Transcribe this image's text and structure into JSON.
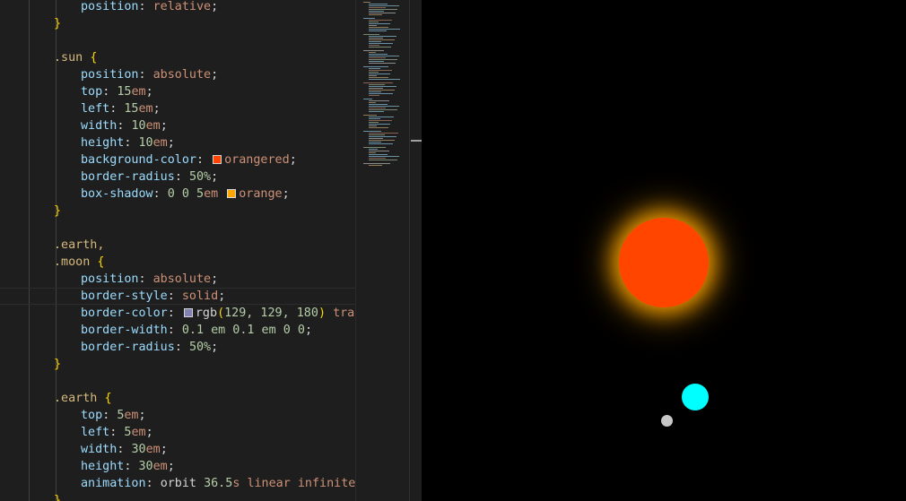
{
  "code": {
    "l1_prop": "position",
    "l1_val": "relative",
    "close1": "}",
    "sun_sel": ".sun",
    "open_brace": "{",
    "sun_position_prop": "position",
    "sun_position_val": "absolute",
    "sun_top_prop": "top",
    "sun_top_num": "15",
    "sun_top_unit": "em",
    "sun_left_prop": "left",
    "sun_left_num": "15",
    "sun_left_unit": "em",
    "sun_width_prop": "width",
    "sun_width_num": "10",
    "sun_width_unit": "em",
    "sun_height_prop": "height",
    "sun_height_num": "10",
    "sun_height_unit": "em",
    "sun_bg_prop": "background-color",
    "sun_bg_val": "orangered",
    "sun_radius_prop": "border-radius",
    "sun_radius_num": "50%",
    "sun_shadow_prop": "box-shadow",
    "sun_shadow_num": "0 0 5",
    "sun_shadow_unit": "em",
    "sun_shadow_val": "orange",
    "close2": "}",
    "earth_sel_a": ".earth,",
    "moon_sel": ".moon",
    "em_position_prop": "position",
    "em_position_val": "absolute",
    "em_bstyle_prop": "border-style",
    "em_bstyle_val": "solid",
    "em_bcolor_prop": "border-color",
    "em_bcolor_fn": "rgb",
    "em_bcolor_open": "(",
    "em_bcolor_nums": "129, 129, 180",
    "em_bcolor_close": ")",
    "em_bcolor_tail": "trans",
    "em_bwidth_prop": "border-width",
    "em_bwidth_nums": "0.1 em 0.1 em 0 0",
    "em_bradius_prop": "border-radius",
    "em_bradius_num": "50%",
    "close3": "}",
    "earth_sel": ".earth",
    "earth_top_prop": "top",
    "earth_top_num": "5",
    "earth_top_unit": "em",
    "earth_left_prop": "left",
    "earth_left_num": "5",
    "earth_left_unit": "em",
    "earth_width_prop": "width",
    "earth_width_num": "30",
    "earth_width_unit": "em",
    "earth_height_prop": "height",
    "earth_height_num": "30",
    "earth_height_unit": "em",
    "earth_anim_prop": "animation",
    "earth_anim_name": "orbit",
    "earth_anim_num": "36.5",
    "earth_anim_unit": "s",
    "earth_anim_kw": "linear infinite",
    "close4": "}",
    "colon": ":",
    "semi": ";"
  },
  "colors": {
    "orangered": "#ff4500",
    "orange": "#ffa500",
    "border_rgb": "#8181b4",
    "earth": "#00ffff",
    "moon": "#c8c8c8"
  }
}
